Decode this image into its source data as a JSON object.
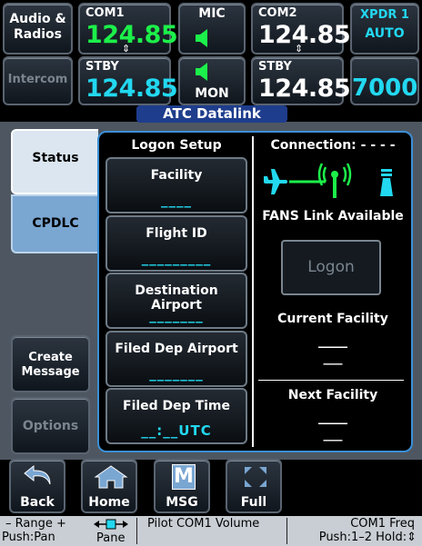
{
  "top_bar": {
    "audio_radios": "Audio &\nRadios",
    "intercom": "Intercom",
    "com1": {
      "label": "COM1",
      "active": "124.85",
      "stby_label": "STBY",
      "standby": "124.85",
      "swap": "⇕"
    },
    "mic": {
      "label": "MIC",
      "mon_label": "MON"
    },
    "com2": {
      "label": "COM2",
      "active": "124.85",
      "stby_label": "STBY",
      "standby": "124.85",
      "swap": "⇕"
    },
    "xpdr": {
      "label": "XPDR 1",
      "mode": "AUTO",
      "code": "7000"
    }
  },
  "title": "ATC Datalink",
  "tabs": {
    "status": "Status",
    "cpdlc": "CPDLC"
  },
  "side_buttons": {
    "create_message": "Create\nMessage",
    "options": "Options"
  },
  "logon_setup": {
    "heading": "Logon Setup",
    "fields": [
      {
        "label": "Facility",
        "value": "____"
      },
      {
        "label": "Flight ID",
        "value": "_________"
      },
      {
        "label": "Destination Airport",
        "value": "_______"
      },
      {
        "label": "Filed Dep Airport",
        "value": "_______"
      },
      {
        "label": "Filed Dep Time",
        "value": "__:__UTC"
      }
    ]
  },
  "connection": {
    "label": "Connection:",
    "value": "- - - -",
    "link_status": "FANS Link Available",
    "logon_button": "Logon",
    "current_facility_label": "Current Facility",
    "current_facility_value": "____",
    "current_facility_value2": "___",
    "next_facility_label": "Next Facility",
    "next_facility_value": "____",
    "next_facility_value2": "___"
  },
  "soft_keys": {
    "back": "Back",
    "home": "Home",
    "msg": "MSG",
    "full": "Full",
    "msg_glyph": "M"
  },
  "status_bar": {
    "range": "– Range +",
    "push_pan": "Push:Pan",
    "pane": "Pane",
    "pilot_com1_volume": "Pilot COM1 Volume",
    "com1_freq": "COM1 Freq",
    "push_hold": "Push:1–2 Hold:⇕"
  },
  "colors": {
    "active_freq": "#1cf04a",
    "standby_freq": "#22d8f0",
    "panel_border": "#3c8fd6",
    "title_bar": "#1e3d8c"
  }
}
